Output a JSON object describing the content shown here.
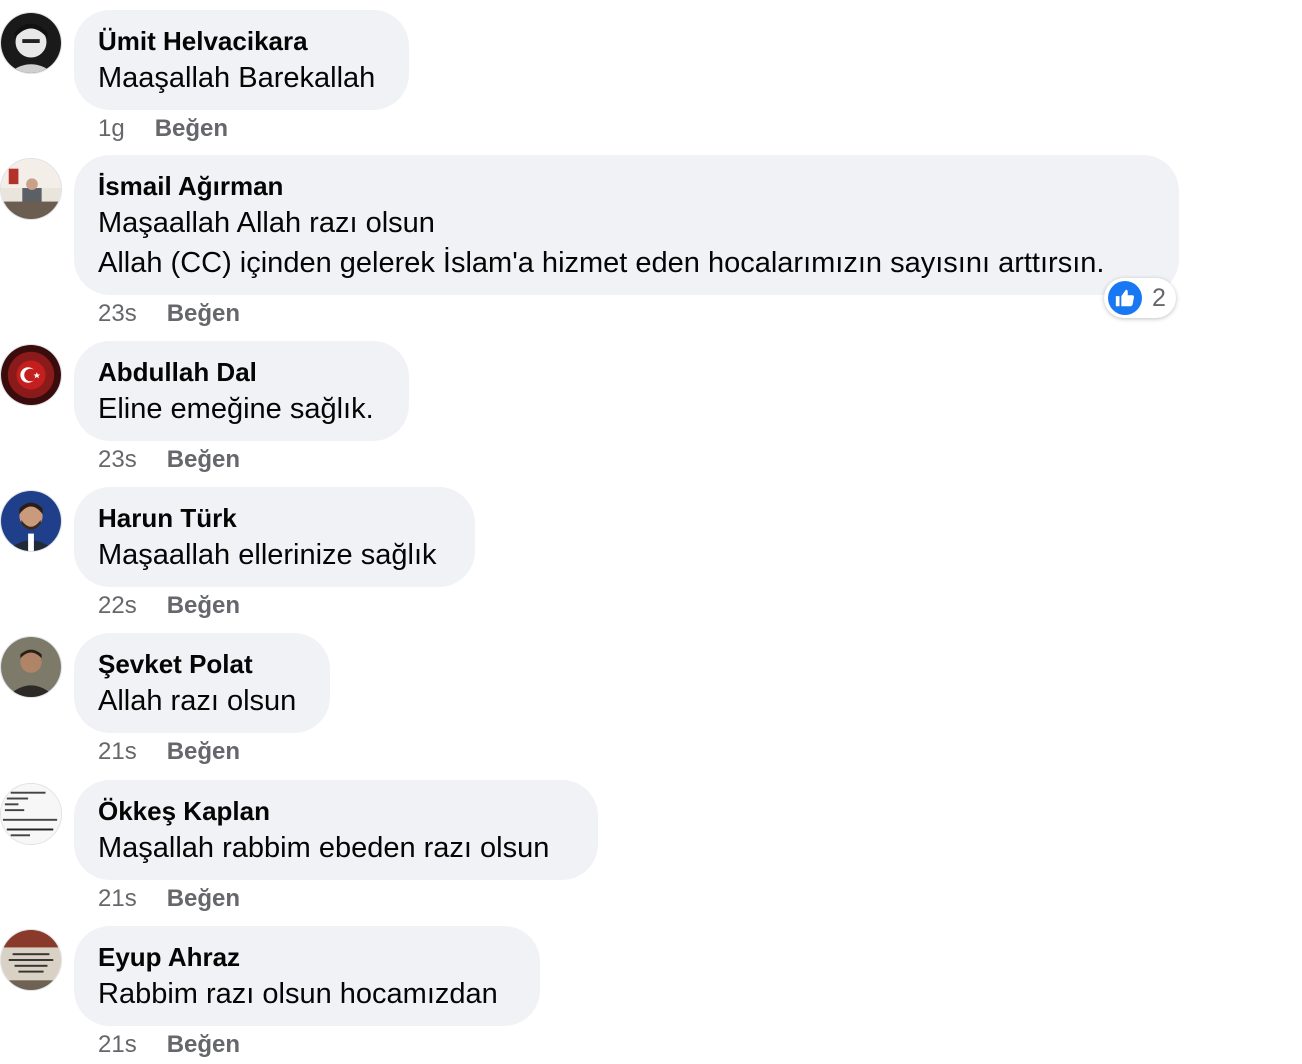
{
  "comments": [
    {
      "author": "Ümit Helvacikara",
      "lines": [
        "Maaşallah Barekallah"
      ],
      "time": "1g",
      "like_label": "Beğen"
    },
    {
      "author": "İsmail Ağırman",
      "lines": [
        "Maşaallah Allah razı olsun",
        "Allah (CC) içinden gelerek İslam'a hizmet eden hocalarımızın sayısını arttırsın."
      ],
      "time": "23s",
      "like_label": "Beğen",
      "reactions": {
        "icon": "thumbs-up-icon",
        "count": "2"
      }
    },
    {
      "author": "Abdullah Dal",
      "lines": [
        "Eline emeğine sağlık."
      ],
      "time": "23s",
      "like_label": "Beğen"
    },
    {
      "author": "Harun Türk",
      "lines": [
        "Maşaallah ellerinize sağlık"
      ],
      "time": "22s",
      "like_label": "Beğen"
    },
    {
      "author": "Şevket Polat",
      "lines": [
        "Allah razı olsun"
      ],
      "time": "21s",
      "like_label": "Beğen"
    },
    {
      "author": "Ökkeş Kaplan",
      "lines": [
        "Maşallah rabbim ebeden razı olsun"
      ],
      "time": "21s",
      "like_label": "Beğen"
    },
    {
      "author": "Eyup Ahraz",
      "lines": [
        "Rabbim razı olsun hocamızdan"
      ],
      "time": "21s",
      "like_label": "Beğen"
    }
  ],
  "colors": {
    "bubble_bg": "#f0f2f5",
    "text": "#050505",
    "meta": "#65676b",
    "like_blue": "#1877f2"
  }
}
